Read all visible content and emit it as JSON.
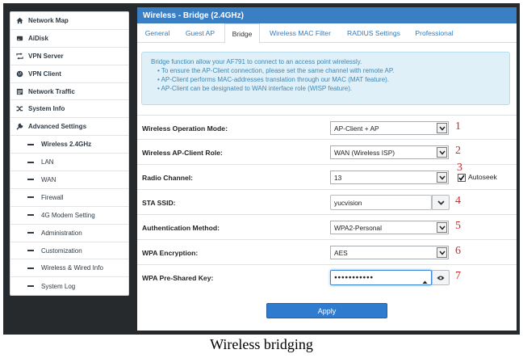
{
  "sidebar": {
    "items": [
      {
        "label": "Network Map",
        "icon": "home-icon"
      },
      {
        "label": "AiDisk",
        "icon": "disk-icon"
      },
      {
        "label": "VPN Server",
        "icon": "vpn-server-icon"
      },
      {
        "label": "VPN Client",
        "icon": "globe-icon"
      },
      {
        "label": "Network Traffic",
        "icon": "traffic-icon"
      },
      {
        "label": "System Info",
        "icon": "shuffle-icon"
      },
      {
        "label": "Advanced Settings",
        "icon": "wrench-icon"
      }
    ],
    "subitems": [
      {
        "label": "Wireless 2.4GHz",
        "active": true
      },
      {
        "label": "LAN"
      },
      {
        "label": "WAN"
      },
      {
        "label": "Firewall"
      },
      {
        "label": "4G Modem Setting"
      },
      {
        "label": "Administration"
      },
      {
        "label": "Customization"
      },
      {
        "label": "Wireless & Wired Info"
      },
      {
        "label": "System Log"
      }
    ]
  },
  "panel": {
    "title": "Wireless - Bridge (2.4GHz)",
    "tabs": [
      "General",
      "Guest AP",
      "Bridge",
      "Wireless MAC Filter",
      "RADIUS Settings",
      "Professional"
    ],
    "active_tab": "Bridge"
  },
  "info": {
    "intro": "Bridge function allow your AF791 to connect to an access point wirelessly.",
    "bullets": [
      "• To ensure the AP-Client connection, please set the same channel with remote AP.",
      "• AP-Client performs MAC-addresses translation through our MAC (MAT feature).",
      "• AP-Client can be designated to WAN interface role (WISP feature)."
    ]
  },
  "form": {
    "operation_mode": {
      "label": "Wireless Operation Mode:",
      "value": "AP-Client + AP",
      "marker": "1"
    },
    "client_role": {
      "label": "Wireless AP-Client Role:",
      "value": "WAN (Wireless ISP)",
      "marker": "2"
    },
    "channel": {
      "label": "Radio Channel:",
      "value": "13",
      "marker": "3",
      "autoseek_label": "Autoseek",
      "autoseek_checked": true
    },
    "ssid": {
      "label": "STA SSID:",
      "value": "yucvision",
      "marker": "4"
    },
    "auth": {
      "label": "Authentication Method:",
      "value": "WPA2-Personal",
      "marker": "5"
    },
    "encryption": {
      "label": "WPA Encryption:",
      "value": "AES",
      "marker": "6"
    },
    "psk": {
      "label": "WPA Pre-Shared Key:",
      "value": "●●●●●●●●●●●",
      "marker": "7"
    }
  },
  "apply_label": "Apply",
  "caption": "Wireless bridging",
  "colors": {
    "accent": "#3a7fc4",
    "marker": "#d8232a",
    "frame": "#262a2d"
  }
}
